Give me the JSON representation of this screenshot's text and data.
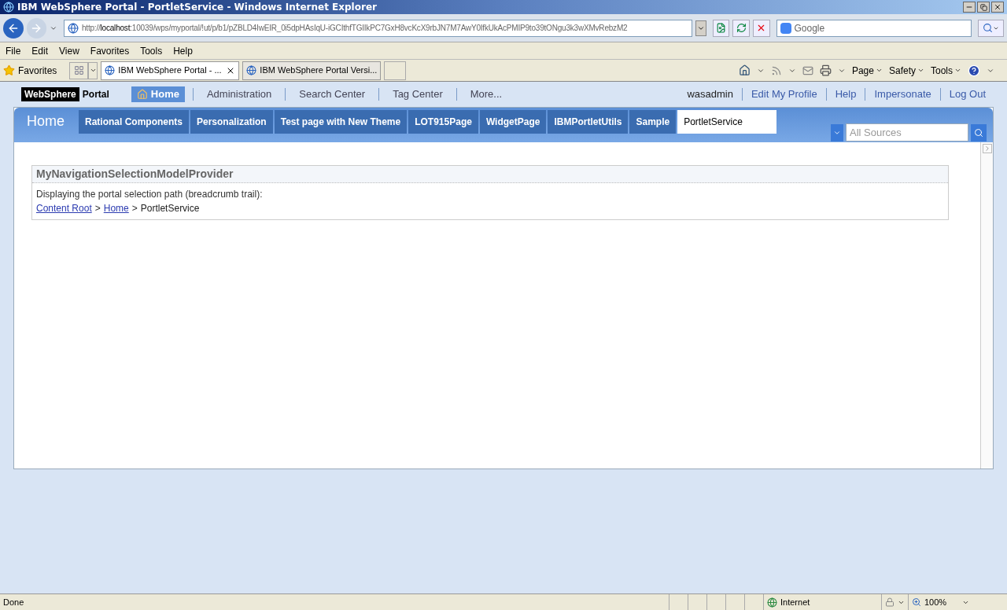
{
  "window": {
    "title": "IBM WebSphere Portal - PortletService - Windows Internet Explorer"
  },
  "address_bar": {
    "url_prefix": "http://",
    "url_host": "localhost",
    "url_rest": ":10039/wps/myportal/!ut/p/b1/pZBLD4IwEIR_0i5dpHAsIqU-iGCIthfTGIIkPC7GxH8vcKcX9rbJN7M7AwY0IfkUkAcPMIP9to39tONgu3k3wXMvRebzM2"
  },
  "search_box": {
    "placeholder": "Google"
  },
  "menu_bar": [
    "File",
    "Edit",
    "View",
    "Favorites",
    "Tools",
    "Help"
  ],
  "favorites_label": "Favorites",
  "browser_tabs": [
    {
      "label": "IBM WebSphere Portal - ...",
      "selected": true
    },
    {
      "label": "IBM WebSphere Portal Versi...",
      "selected": false
    }
  ],
  "command_bar": [
    "Page",
    "Safety",
    "Tools"
  ],
  "portal": {
    "logo_brand": "WebSphere",
    "logo_product": "Portal",
    "top_nav": [
      {
        "label": "Home",
        "selected": true
      },
      {
        "label": "Administration",
        "selected": false
      },
      {
        "label": "Search Center",
        "selected": false
      },
      {
        "label": "Tag Center",
        "selected": false
      },
      {
        "label": "More...",
        "selected": false
      }
    ],
    "user": "wasadmin",
    "user_links": [
      "Edit My Profile",
      "Help",
      "Impersonate",
      "Log Out"
    ],
    "home_label": "Home",
    "page_tabs": [
      {
        "label": "Rational Components",
        "selected": false
      },
      {
        "label": "Personalization",
        "selected": false
      },
      {
        "label": "Test page with New Theme",
        "selected": false
      },
      {
        "label": "LOT915Page",
        "selected": false
      },
      {
        "label": "WidgetPage",
        "selected": false
      },
      {
        "label": "IBMPortletUtils",
        "selected": false
      },
      {
        "label": "Sample",
        "selected": false
      },
      {
        "label": "PortletService",
        "selected": true
      }
    ],
    "search_placeholder": "All Sources",
    "portlet": {
      "title": "MyNavigationSelectionModelProvider",
      "description": "Displaying the portal selection path (breadcrumb trail):",
      "breadcrumb": [
        {
          "label": "Content Root",
          "kind": "link"
        },
        {
          "label": ">",
          "kind": "separator"
        },
        {
          "label": "Home",
          "kind": "link"
        },
        {
          "label": ">",
          "kind": "separator"
        },
        {
          "label": "PortletService",
          "kind": "text"
        }
      ]
    }
  },
  "status_bar": {
    "status": "Done",
    "zone": "Internet",
    "zoom": "100%"
  }
}
